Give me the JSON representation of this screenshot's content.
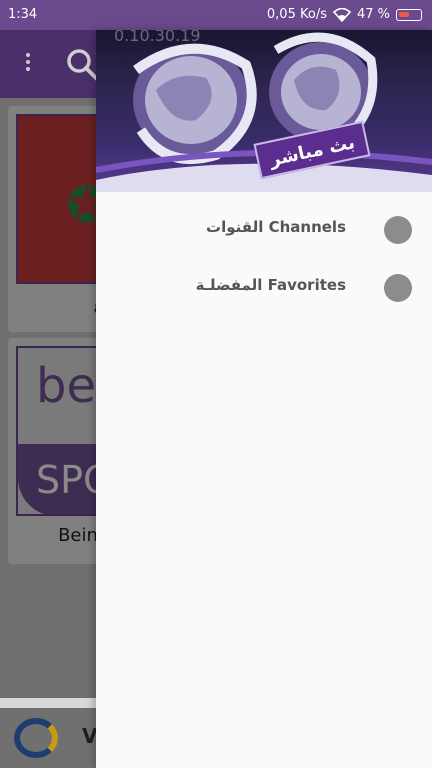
{
  "status_bar": {
    "time": "1:34",
    "speed": "0,05 Ko/s",
    "battery": "47 %"
  },
  "app": {
    "card1_label": "ع",
    "card2_label": "Bein",
    "bein_logo_top": "be",
    "bein_logo_bottom": "SPO",
    "ad_letter": "V"
  },
  "drawer": {
    "header": {
      "badge": "بث مباشر",
      "clock": "0.10.30.19"
    },
    "items": [
      {
        "label": "القنوات Channels",
        "icon": "circle-icon"
      },
      {
        "label": "المفضلـة Favorites",
        "icon": "circle-icon"
      }
    ]
  },
  "colors": {
    "status_bar": "#6a4a8c",
    "drawer_header_accent": "#5b2d8e",
    "nav_dot": "#8c8c8c"
  }
}
